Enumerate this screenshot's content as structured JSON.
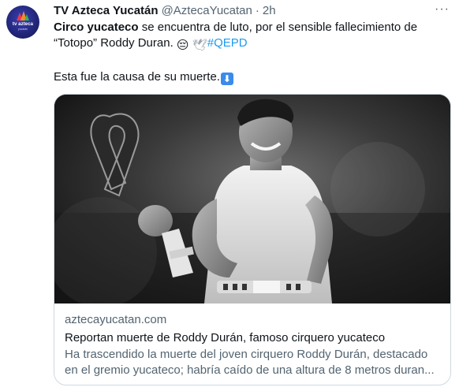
{
  "tweet": {
    "author_name": "TV Azteca Yucatán",
    "handle": "@AztecaYucatan",
    "separator": "·",
    "time": "2h",
    "more_label": "···",
    "text_bold": "Circo yucateco",
    "text_part1": " se encuentra de luto, por el sensible fallecimiento de “Totopo” Roddy Duran. ",
    "emoji_1": "😔",
    "emoji_2": "🕊",
    "hashtag": "#QEPD",
    "line2": "Esta fue la causa de su muerte.",
    "arrow_emoji": "⬇"
  },
  "avatar": {
    "logo_text": "tv azteca",
    "logo_sub": "yucatán"
  },
  "card": {
    "domain": "aztecayucatan.com",
    "title": "Reportan muerte de Roddy Durán, famoso cirquero yucateco",
    "description": "Ha trascendido la muerte del joven cirquero Roddy Durán, destacado en el gremio yucateco; habría caído de una altura de 8 metros duran..."
  },
  "colors": {
    "link": "#1d9bf0",
    "secondary_text": "#536471",
    "border": "#cfd9de"
  }
}
